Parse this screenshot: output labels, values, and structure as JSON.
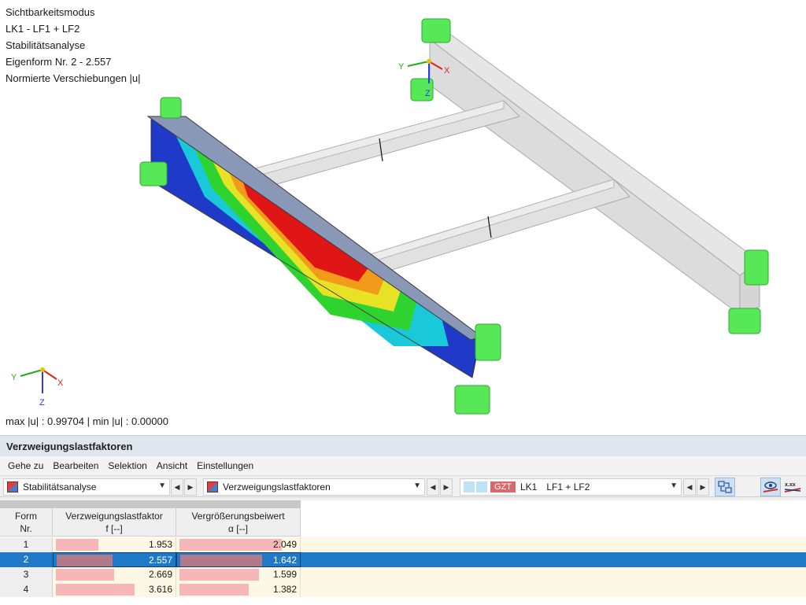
{
  "viewport": {
    "info_lines": [
      "Sichtbarkeitsmodus",
      "LK1 - LF1 + LF2",
      "Stabilitätsanalyse",
      "Eigenform Nr. 2 - 2.557",
      "Normierte Verschiebungen |u|"
    ],
    "minmax": "max |u| : 0.99704 | min |u| : 0.00000",
    "axes_global": {
      "x": "X",
      "y": "Y",
      "z": "Z"
    },
    "axes_local": {
      "x": "X",
      "y": "Y",
      "z": "Z"
    }
  },
  "panel": {
    "title": "Verzweigungslastfaktoren",
    "menu": [
      "Gehe zu",
      "Bearbeiten",
      "Selektion",
      "Ansicht",
      "Einstellungen"
    ],
    "toolbar": {
      "analysis_combo": "Stabilitätsanalyse",
      "result_combo": "Verzweigungslastfaktoren",
      "load_badge": "GZT",
      "load_case": "LK1",
      "load_combo": "LF1 + LF2"
    },
    "table": {
      "headers": {
        "form_line1": "Form",
        "form_line2": "Nr.",
        "factor_line1": "Verzweigungslastfaktor",
        "factor_line2": "f [--]",
        "amp_line1": "Vergrößerungsbeiwert",
        "amp_line2": "α [--]"
      },
      "rows": [
        {
          "nr": "1",
          "factor": "1.953",
          "factor_value": 1.953,
          "amp": "2.049",
          "amp_value": 2.049,
          "selected": false
        },
        {
          "nr": "2",
          "factor": "2.557",
          "factor_value": 2.557,
          "amp": "1.642",
          "amp_value": 1.642,
          "selected": true
        },
        {
          "nr": "3",
          "factor": "2.669",
          "factor_value": 2.669,
          "amp": "1.599",
          "amp_value": 1.599,
          "selected": false
        },
        {
          "nr": "4",
          "factor": "3.616",
          "factor_value": 3.616,
          "amp": "1.382",
          "amp_value": 1.382,
          "selected": false
        }
      ]
    }
  },
  "colors": {
    "selection": "#1e7ac9",
    "support": "#4ee64e",
    "bar": "#f5b7b7",
    "gzt": "#d76a6a"
  }
}
